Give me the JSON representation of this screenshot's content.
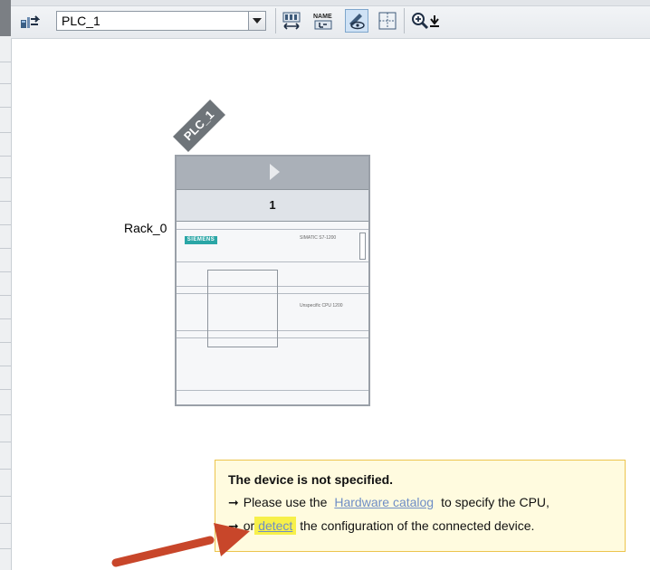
{
  "toolbar": {
    "device_selected": "PLC_1"
  },
  "device": {
    "plc_tag": "PLC_1",
    "rack_label": "Rack_0",
    "slot_number": "1",
    "brand": "SIEMENS",
    "model": "SIMATIC S7-1200",
    "cpu_desc": "Unspecific CPU 1200"
  },
  "info": {
    "title": "The device is not specified.",
    "line1_prefix": "Please use the",
    "line1_link": "Hardware catalog",
    "line1_suffix": "to specify the CPU,",
    "line2_prefix": "or",
    "line2_link": "detect",
    "line2_suffix": "the configuration of the connected device."
  },
  "colors": {
    "info_bg": "#fffbdf",
    "info_border": "#ecc44d",
    "link": "#6f8ec6",
    "highlight": "#f7f04a",
    "pointer_arrow": "#c8462a"
  }
}
